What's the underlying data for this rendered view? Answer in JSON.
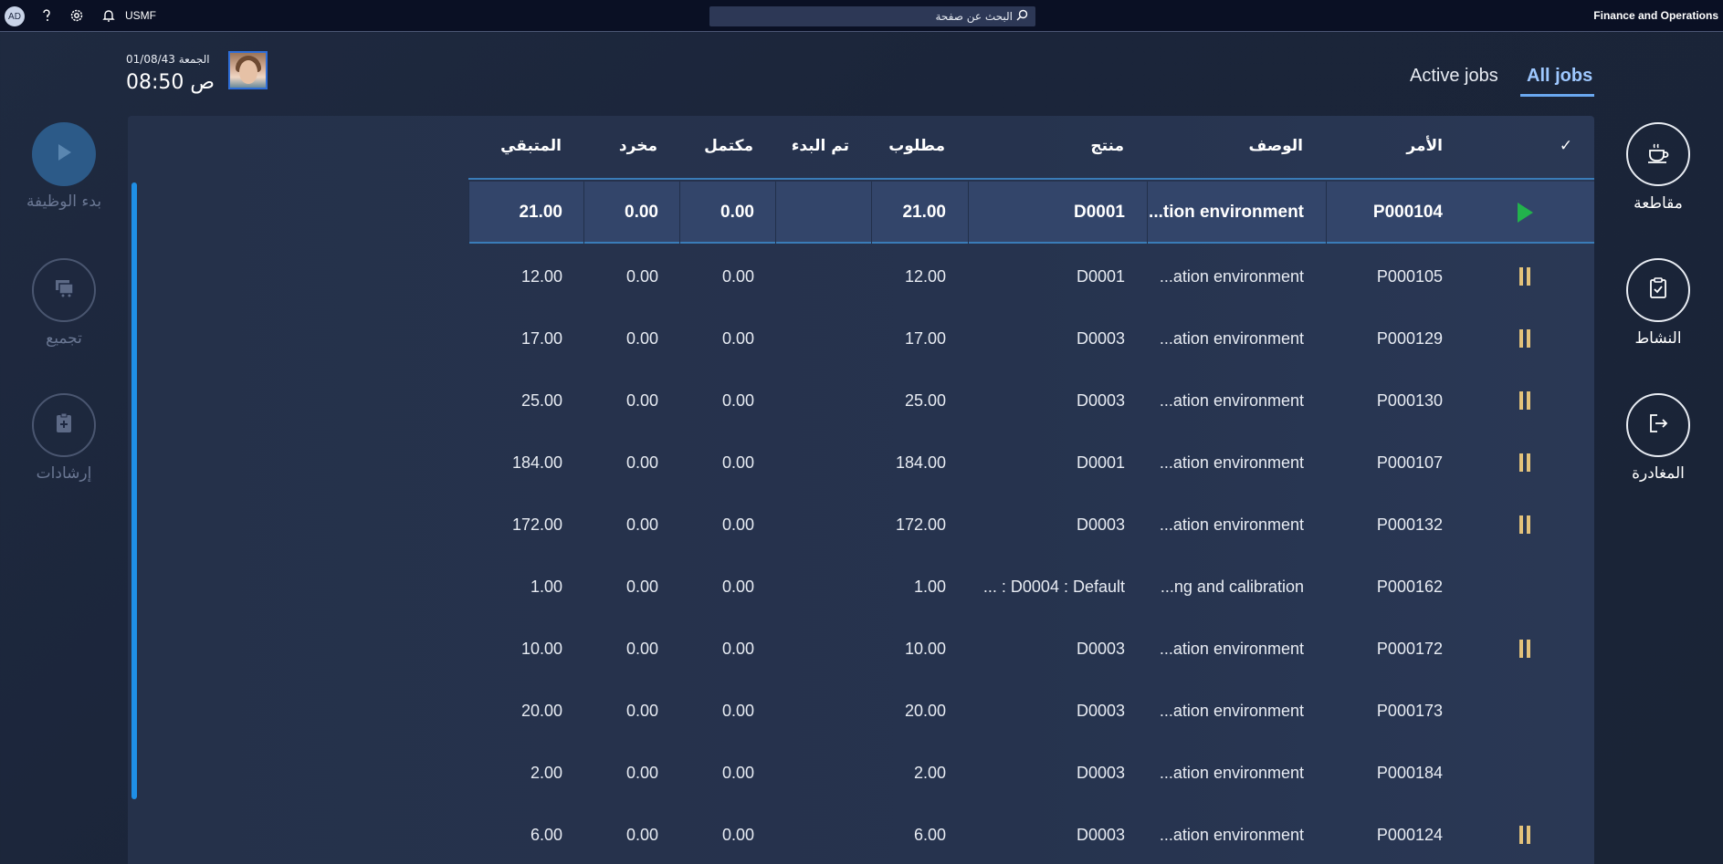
{
  "topbar": {
    "user_initials": "AD",
    "help_icon": "help-icon",
    "settings_icon": "gear-icon",
    "notification_icon": "bell-icon",
    "company": "USMF",
    "search_placeholder": "البحث عن صفحة",
    "app_name": "Finance and Operations"
  },
  "user": {
    "date": "الجمعة 01/08/43",
    "time": "08:50 ص"
  },
  "tabs": [
    {
      "label": "Active jobs",
      "active": false
    },
    {
      "label": "All jobs",
      "active": true
    }
  ],
  "left_actions": [
    {
      "label": "بدء الوظيفة",
      "icon": "play-icon",
      "enabled": false
    },
    {
      "label": "تجميع",
      "icon": "bundle-icon",
      "enabled": false
    },
    {
      "label": "إرشادات",
      "icon": "instructions-icon",
      "enabled": false
    }
  ],
  "right_actions": [
    {
      "label": "مقاطعة",
      "icon": "coffee-cup-icon"
    },
    {
      "label": "النشاط",
      "icon": "clipboard-check-icon"
    },
    {
      "label": "المغادرة",
      "icon": "sign-out-icon"
    }
  ],
  "grid": {
    "columns": {
      "select": "✓",
      "order": "الأمر",
      "description": "الوصف",
      "product": "منتج",
      "required": "مطلوب",
      "started": "تم البدء",
      "completed": "مكتمل",
      "scrapped": "مخرد",
      "remaining": "المتبقي"
    },
    "rows": [
      {
        "status": "running",
        "order": "P000104",
        "description": "...tion environment",
        "product": "D0001",
        "required": "21.00",
        "started": "",
        "completed": "0.00",
        "scrapped": "0.00",
        "remaining": "21.00",
        "selected": true
      },
      {
        "status": "paused",
        "order": "P000105",
        "description": "...ation environment",
        "product": "D0001",
        "required": "12.00",
        "started": "",
        "completed": "0.00",
        "scrapped": "0.00",
        "remaining": "12.00",
        "selected": false
      },
      {
        "status": "paused",
        "order": "P000129",
        "description": "...ation environment",
        "product": "D0003",
        "required": "17.00",
        "started": "",
        "completed": "0.00",
        "scrapped": "0.00",
        "remaining": "17.00",
        "selected": false
      },
      {
        "status": "paused",
        "order": "P000130",
        "description": "...ation environment",
        "product": "D0003",
        "required": "25.00",
        "started": "",
        "completed": "0.00",
        "scrapped": "0.00",
        "remaining": "25.00",
        "selected": false
      },
      {
        "status": "paused",
        "order": "P000107",
        "description": "...ation environment",
        "product": "D0001",
        "required": "184.00",
        "started": "",
        "completed": "0.00",
        "scrapped": "0.00",
        "remaining": "184.00",
        "selected": false
      },
      {
        "status": "paused",
        "order": "P000132",
        "description": "...ation environment",
        "product": "D0003",
        "required": "172.00",
        "started": "",
        "completed": "0.00",
        "scrapped": "0.00",
        "remaining": "172.00",
        "selected": false
      },
      {
        "status": "none",
        "order": "P000162",
        "description": "...ng and calibration",
        "product": "... : D0004 : Default",
        "required": "1.00",
        "started": "",
        "completed": "0.00",
        "scrapped": "0.00",
        "remaining": "1.00",
        "selected": false
      },
      {
        "status": "paused",
        "order": "P000172",
        "description": "...ation environment",
        "product": "D0003",
        "required": "10.00",
        "started": "",
        "completed": "0.00",
        "scrapped": "0.00",
        "remaining": "10.00",
        "selected": false
      },
      {
        "status": "none",
        "order": "P000173",
        "description": "...ation environment",
        "product": "D0003",
        "required": "20.00",
        "started": "",
        "completed": "0.00",
        "scrapped": "0.00",
        "remaining": "20.00",
        "selected": false
      },
      {
        "status": "none",
        "order": "P000184",
        "description": "...ation environment",
        "product": "D0003",
        "required": "2.00",
        "started": "",
        "completed": "0.00",
        "scrapped": "0.00",
        "remaining": "2.00",
        "selected": false
      },
      {
        "status": "paused",
        "order": "P000124",
        "description": "...ation environment",
        "product": "D0003",
        "required": "6.00",
        "started": "",
        "completed": "0.00",
        "scrapped": "0.00",
        "remaining": "6.00",
        "selected": false
      }
    ]
  },
  "colors": {
    "running": "#22b24c",
    "paused": "#e3c27a",
    "accent": "#6aa8f0"
  }
}
